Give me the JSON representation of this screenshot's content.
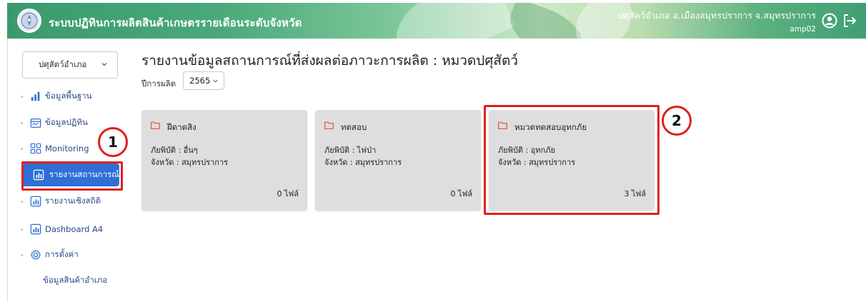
{
  "header": {
    "title": "ระบบปฏิทินการผลิตสินค้าเกษตรรายเดือนระดับจังหวัด",
    "user_name": "ปศุสัตว์อำเภอ อ.เมืองสมุทรปราการ จ.สมุทรปราการ",
    "user_id": "amp02",
    "icons": [
      "government-seal-icon",
      "user-circle-icon",
      "logout-icon"
    ]
  },
  "sidebar": {
    "role_select": "ปศุสัตว์อำเภอ",
    "items": [
      {
        "label": "ข้อมูลพื้นฐาน",
        "icon": "bar-chart-icon"
      },
      {
        "label": "ข้อมูลปฏิทิน",
        "icon": "calendar-icon"
      },
      {
        "label": "Monitoring",
        "icon": "grid-icon"
      },
      {
        "label": "รายงานสถานการณ์",
        "icon": "report-icon",
        "active": true
      },
      {
        "label": "รายงานเชิงสถิติ",
        "icon": "report-icon"
      },
      {
        "label": "Dashboard A4",
        "icon": "report-icon"
      },
      {
        "label": "การตั้งค่า",
        "icon": "gear-icon"
      }
    ],
    "sub_item": "ข้อมูลสินค้าอำเภอ"
  },
  "main": {
    "title": "รายงานข้อมูลสถานการณ์ที่ส่งผลต่อภาวะการผลิต : หมวดปศุสัตว์",
    "year_label": "ปีการผลิต",
    "year_value": "2565",
    "cards": [
      {
        "name": "ฝีดาดสิง",
        "line1": "ภัยพิบัติ : อื่นๆ",
        "line2": "จังหวัด : สมุทรปราการ",
        "files": "0 ไฟล์"
      },
      {
        "name": "ทดสอบ",
        "line1": "ภัยพิบัติ : ไฟป่า",
        "line2": "จังหวัด : สมุทรปราการ",
        "files": "0 ไฟล์"
      },
      {
        "name": "หมวดทดสอบอุทกภัย",
        "line1": "ภัยพิบัติ : อุทกภัย",
        "line2": "จังหวัด : สมุทรปราการ",
        "files": "3 ไฟล์"
      }
    ]
  },
  "annotations": {
    "marker_1": "1",
    "marker_2": "2",
    "highlight_color": "#e0201c"
  },
  "colors": {
    "accent": "#2f6fd6",
    "header_green": "#3a9a6e",
    "folder": "#e2553b"
  }
}
